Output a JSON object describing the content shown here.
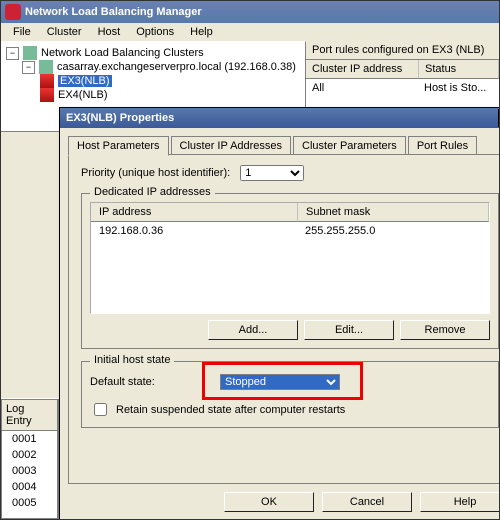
{
  "window": {
    "title": "Network Load Balancing Manager",
    "menu": {
      "file": "File",
      "cluster": "Cluster",
      "host": "Host",
      "options": "Options",
      "help": "Help"
    }
  },
  "tree": {
    "root": "Network Load Balancing Clusters",
    "cluster": "casarray.exchangeserverpro.local (192.168.0.38)",
    "nodes": [
      "EX3(NLB)",
      "EX4(NLB)"
    ]
  },
  "rules": {
    "title": "Port rules configured on EX3 (NLB)",
    "head_ip": "Cluster IP address",
    "head_status": "Status",
    "row_ip": "All",
    "row_status": "Host is Sto..."
  },
  "log": {
    "header": "Log Entry",
    "rows": [
      "0001",
      "0002",
      "0003",
      "0004",
      "0005"
    ]
  },
  "dialog": {
    "title": "EX3(NLB) Properties",
    "tabs": {
      "host": "Host Parameters",
      "cip": "Cluster IP Addresses",
      "cpar": "Cluster Parameters",
      "port": "Port Rules"
    },
    "priority_label": "Priority (unique host identifier):",
    "priority_value": "1",
    "dedicated_group": "Dedicated IP addresses",
    "ip_head": "IP address",
    "mask_head": "Subnet mask",
    "ip_val": "192.168.0.36",
    "mask_val": "255.255.255.0",
    "btn_add": "Add...",
    "btn_edit": "Edit...",
    "btn_remove": "Remove",
    "initial_group": "Initial host state",
    "default_state_label": "Default state:",
    "default_state_value": "Stopped",
    "retain_label": "Retain suspended state after computer restarts",
    "ok": "OK",
    "cancel": "Cancel",
    "help": "Help"
  }
}
